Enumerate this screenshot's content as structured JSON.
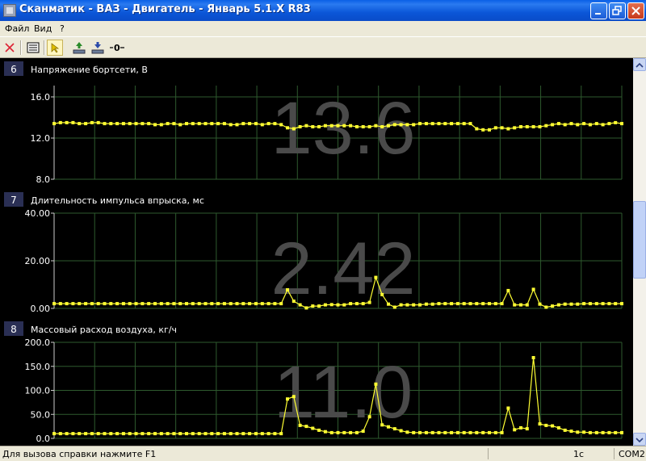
{
  "window": {
    "title": "Сканматик - ВАЗ - Двигатель - Январь 5.1.X R83"
  },
  "menu": [
    "Файл",
    "Вид",
    "?"
  ],
  "toolbar": {
    "icons": [
      "close-icon",
      "list-icon",
      "pointer-icon",
      "upload-icon",
      "download-icon",
      "zero-icon"
    ]
  },
  "panels": [
    {
      "number": "6",
      "title": "Напряжение бортсети, В",
      "value": "13.6",
      "y_ticks": [
        "16.0",
        "12.0",
        "8.0"
      ],
      "chart_data": {
        "type": "line",
        "title": "Напряжение бортсети, В",
        "ylim": [
          8,
          16
        ],
        "y_tick_values": [
          16,
          12,
          8
        ],
        "grid": true,
        "series": [
          {
            "color": "#ffff33",
            "values": [
              13.4,
              13.5,
              13.5,
              13.5,
              13.4,
              13.4,
              13.5,
              13.5,
              13.4,
              13.4,
              13.4,
              13.4,
              13.4,
              13.4,
              13.4,
              13.4,
              13.3,
              13.3,
              13.4,
              13.4,
              13.3,
              13.4,
              13.4,
              13.4,
              13.4,
              13.4,
              13.4,
              13.4,
              13.3,
              13.3,
              13.4,
              13.4,
              13.4,
              13.3,
              13.4,
              13.4,
              13.3,
              13.0,
              12.9,
              13.1,
              13.2,
              13.1,
              13.1,
              13.2,
              13.2,
              13.2,
              13.2,
              13.2,
              13.1,
              13.1,
              13.1,
              13.2,
              13.1,
              13.2,
              13.3,
              13.3,
              13.3,
              13.3,
              13.4,
              13.4,
              13.4,
              13.4,
              13.4,
              13.4,
              13.4,
              13.4,
              13.4,
              12.9,
              12.8,
              12.8,
              13.0,
              13.0,
              12.9,
              13.0,
              13.1,
              13.1,
              13.1,
              13.1,
              13.2,
              13.3,
              13.4,
              13.3,
              13.4,
              13.3,
              13.4,
              13.3,
              13.4,
              13.3,
              13.4,
              13.5,
              13.4
            ]
          }
        ]
      }
    },
    {
      "number": "7",
      "title": "Длительность импульса впрыска, мс",
      "value": "2.42",
      "y_ticks": [
        "40.00",
        "20.00",
        "0.00"
      ],
      "chart_data": {
        "type": "line",
        "title": "Длительность импульса впрыска, мс",
        "ylim": [
          0,
          40
        ],
        "y_tick_values": [
          40,
          20,
          0
        ],
        "grid": true,
        "series": [
          {
            "color": "#ffff33",
            "values": [
              2.0,
              2.0,
              2.0,
              2.0,
              2.0,
              2.0,
              2.0,
              2.0,
              2.0,
              2.0,
              2.0,
              2.0,
              2.0,
              2.0,
              2.0,
              2.0,
              2.0,
              2.0,
              2.0,
              2.0,
              2.0,
              2.0,
              2.0,
              2.0,
              2.0,
              2.0,
              2.0,
              2.0,
              2.0,
              2.0,
              2.0,
              2.0,
              2.0,
              2.0,
              2.0,
              2.0,
              2.0,
              7.8,
              3.0,
              1.5,
              0.2,
              1.0,
              1.0,
              1.5,
              1.6,
              1.5,
              1.5,
              2.0,
              2.0,
              2.0,
              2.5,
              13.0,
              5.8,
              1.8,
              0.5,
              1.5,
              1.5,
              1.5,
              1.5,
              1.8,
              1.8,
              2.0,
              2.0,
              2.0,
              2.0,
              2.0,
              2.0,
              2.0,
              2.0,
              2.0,
              2.0,
              2.0,
              7.5,
              1.5,
              1.5,
              1.5,
              8.0,
              1.8,
              0.5,
              1.0,
              1.5,
              1.8,
              1.8,
              1.8,
              2.0,
              2.0,
              2.0,
              2.0,
              2.0,
              2.0,
              2.0
            ]
          }
        ]
      }
    },
    {
      "number": "8",
      "title": "Массовый расход воздуха, кг/ч",
      "value": "11.0",
      "y_ticks": [
        "200.0",
        "150.0",
        "100.0",
        "50.0",
        "0.0"
      ],
      "chart_data": {
        "type": "line",
        "title": "Массовый расход воздуха, кг/ч",
        "ylim": [
          0,
          200
        ],
        "y_tick_values": [
          200,
          150,
          100,
          50,
          0
        ],
        "grid": true,
        "series": [
          {
            "color": "#ffff33",
            "values": [
              10,
              10,
              10,
              10,
              10,
              10,
              10,
              10,
              10,
              10,
              10,
              10,
              10,
              10,
              10,
              10,
              10,
              10,
              10,
              10,
              10,
              10,
              10,
              10,
              10,
              10,
              10,
              10,
              10,
              10,
              10,
              10,
              10,
              10,
              10,
              10,
              10,
              82,
              87,
              27,
              25,
              21,
              17,
              14,
              12,
              12,
              12,
              12,
              12,
              15,
              45,
              113,
              28,
              24,
              20,
              16,
              13,
              12,
              12,
              12,
              12,
              12,
              12,
              12,
              12,
              12,
              12,
              12,
              12,
              12,
              12,
              12,
              63,
              18,
              22,
              20,
              168,
              30,
              27,
              26,
              22,
              17,
              15,
              13,
              13,
              12,
              12,
              12,
              12,
              12,
              12
            ]
          }
        ]
      }
    }
  ],
  "status": {
    "help_text": "Для вызова справки нажмите F1",
    "interval": "1с",
    "port": "COM2"
  }
}
